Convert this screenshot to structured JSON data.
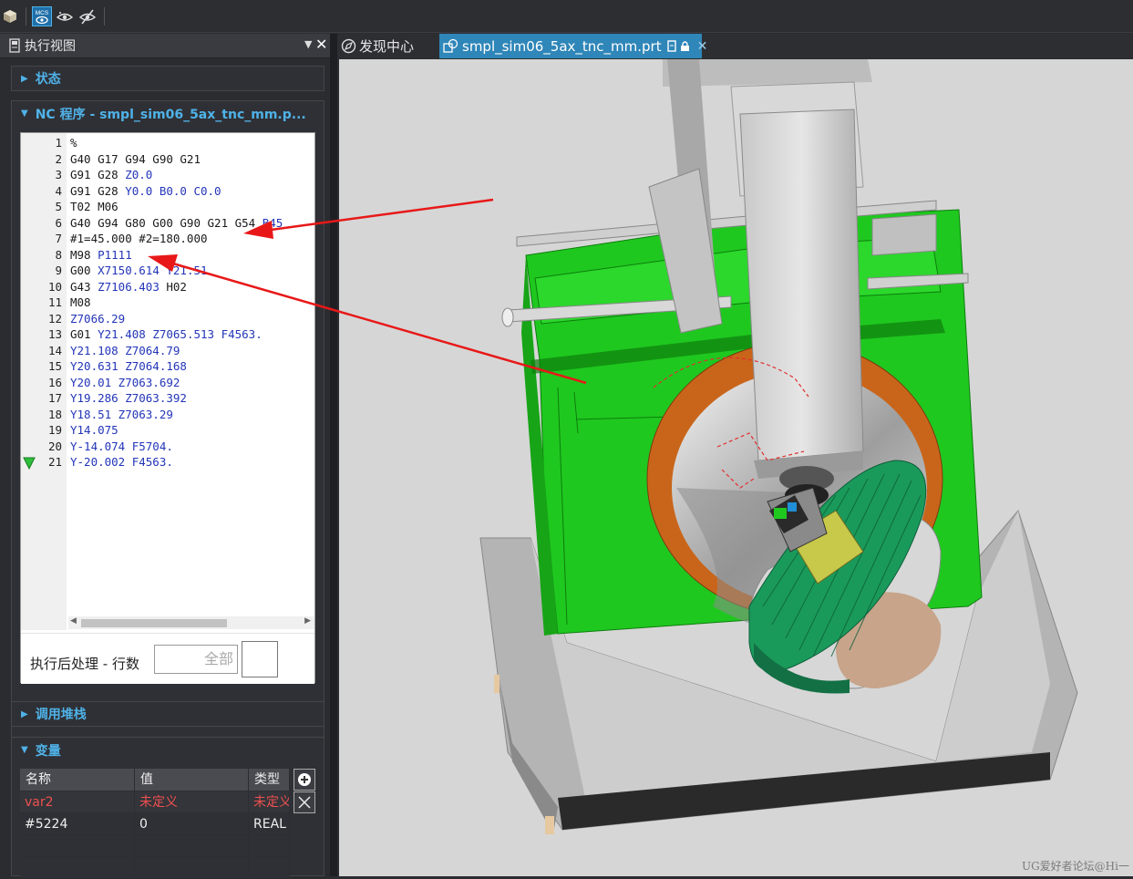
{
  "toolbar": {
    "icons": [
      "cube-icon",
      "mcs-icon",
      "eye-icon",
      "eye-hide-icon"
    ],
    "mcs_label": "MCS"
  },
  "left_panel": {
    "title": "执行视图",
    "sections": {
      "status": "状态",
      "nc_program": "NC 程序 - smpl_sim06_5ax_tnc_mm.p...",
      "call_stack": "调用堆栈",
      "variables": "变量"
    },
    "nc_lines": [
      {
        "n": "1",
        "parts": [
          [
            "%",
            ""
          ]
        ]
      },
      {
        "n": "2",
        "parts": [
          [
            "G40 G17 G94 G90 G21",
            ""
          ]
        ]
      },
      {
        "n": "3",
        "parts": [
          [
            "G91 G28 ",
            ""
          ],
          [
            "Z0.0",
            "a"
          ]
        ]
      },
      {
        "n": "4",
        "parts": [
          [
            "G91 G28 ",
            ""
          ],
          [
            "Y0.0 B0.0 C0.0",
            "a"
          ]
        ]
      },
      {
        "n": "5",
        "parts": [
          [
            "T02 M06",
            ""
          ]
        ]
      },
      {
        "n": "6",
        "parts": [
          [
            "G40 G94 G80 G00 G90 G21 G54 ",
            ""
          ],
          [
            "B45",
            "a"
          ]
        ]
      },
      {
        "n": "7",
        "parts": [
          [
            "#1=45.000 #2=180.000",
            ""
          ]
        ]
      },
      {
        "n": "8",
        "parts": [
          [
            "M98 ",
            ""
          ],
          [
            "P1111",
            "a"
          ]
        ]
      },
      {
        "n": "9",
        "parts": [
          [
            "G00 ",
            ""
          ],
          [
            "X7150.614 Y21.51",
            "a"
          ]
        ]
      },
      {
        "n": "10",
        "parts": [
          [
            "G43 ",
            ""
          ],
          [
            "Z7106.403",
            "a"
          ],
          [
            " H02",
            ""
          ]
        ]
      },
      {
        "n": "11",
        "parts": [
          [
            "M08",
            ""
          ]
        ]
      },
      {
        "n": "12",
        "parts": [
          [
            "Z7066.29",
            "a"
          ]
        ]
      },
      {
        "n": "13",
        "parts": [
          [
            "G01 ",
            ""
          ],
          [
            "Y21.408 Z7065.513 F4563.",
            "a"
          ]
        ]
      },
      {
        "n": "14",
        "parts": [
          [
            "Y21.108 Z7064.79",
            "a"
          ]
        ]
      },
      {
        "n": "15",
        "parts": [
          [
            "Y20.631 Z7064.168",
            "a"
          ]
        ]
      },
      {
        "n": "16",
        "parts": [
          [
            "Y20.01 Z7063.692",
            "a"
          ]
        ]
      },
      {
        "n": "17",
        "parts": [
          [
            "Y19.286 Z7063.392",
            "a"
          ]
        ]
      },
      {
        "n": "18",
        "parts": [
          [
            "Y18.51 Z7063.29",
            "a"
          ]
        ]
      },
      {
        "n": "19",
        "parts": [
          [
            "Y14.075",
            "a"
          ]
        ]
      },
      {
        "n": "20",
        "parts": [
          [
            "Y-14.074 F5704.",
            "a"
          ]
        ]
      },
      {
        "n": "21",
        "parts": [
          [
            "Y-20.002 F4563.",
            "a"
          ]
        ]
      }
    ],
    "current_line": "21",
    "post_label": "执行后处理 - 行数",
    "post_value": "全部",
    "var_columns": [
      "名称",
      "值",
      "类型"
    ],
    "var_rows": [
      {
        "name": "var2",
        "value": "未定义",
        "type": "未定义",
        "undefined": true
      },
      {
        "name": "#5224",
        "value": "0",
        "type": "REAL",
        "undefined": false
      }
    ]
  },
  "tabs": [
    {
      "label": "发现中心",
      "active": false
    },
    {
      "label": "smpl_sim06_5ax_tnc_mm.prt",
      "active": true
    }
  ],
  "watermark": "UG爱好者论坛@Hi一",
  "colors": {
    "accent": "#4fb2e8",
    "active_tab": "#2f86b8",
    "machine_green": "#1fc81f",
    "table_green": "#1a9a5a",
    "annotation_red": "#e81818",
    "undefined_red": "#ef5050"
  }
}
